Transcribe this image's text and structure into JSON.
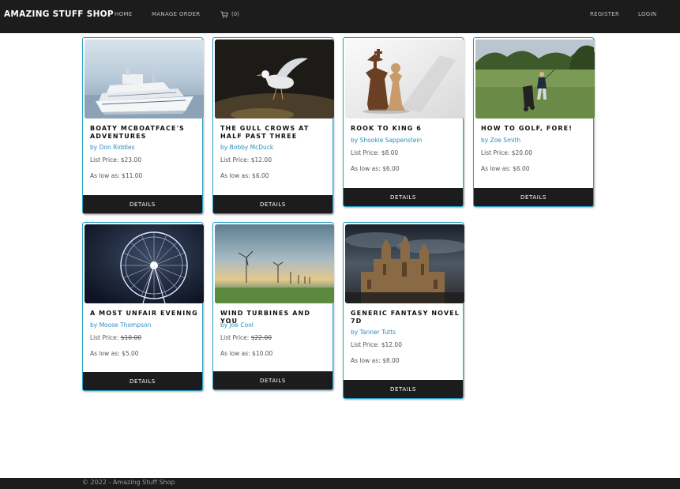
{
  "nav": {
    "brand": "AMAZING STUFF SHOP",
    "home": "HOME",
    "manage_order": "MANAGE ORDER",
    "cart_count": "(0)",
    "register": "REGISTER",
    "login": "LOGIN"
  },
  "books": [
    {
      "title": "BOATY MCBOATFACE'S ADVENTURES",
      "author": "by Don Riddles",
      "list_label": "List Price:",
      "list_price": "$23.00",
      "low_label": "As low as:",
      "low_price": "$11.00",
      "details": "DETAILS"
    },
    {
      "title": "THE GULL CROWS AT HALF PAST THREE",
      "author": "by Bobby McDuck",
      "list_label": "List Price:",
      "list_price": "$12.00",
      "low_label": "As low as:",
      "low_price": "$6.00",
      "details": "DETAILS"
    },
    {
      "title": "ROOK TO KING 6",
      "author": "by Shookie Sappenstein",
      "list_label": "List Price:",
      "list_price": "$8.00",
      "low_label": "As low as:",
      "low_price": "$6.00",
      "details": "DETAILS"
    },
    {
      "title": "HOW TO GOLF, FORE!",
      "author": "by Zoe Smith",
      "list_label": "List Price:",
      "list_price": "$20.00",
      "low_label": "As low as:",
      "low_price": "$6.00",
      "details": "DETAILS"
    },
    {
      "title": "A MOST UNFAIR EVENING",
      "author": "by Moose Thompson",
      "list_label": "List Price:",
      "list_price": "$10.00",
      "low_label": "As low as:",
      "low_price": "$5.00",
      "details": "DETAILS"
    },
    {
      "title": "WIND TURBINES AND YOU",
      "author": "by Joe Cool",
      "list_label": "List Price:",
      "list_price": "$22.00",
      "low_label": "As low as:",
      "low_price": "$10.00",
      "details": "DETAILS"
    },
    {
      "title": "GENERIC FANTASY NOVEL 7D",
      "author": "by Tanner Tutts",
      "list_label": "List Price:",
      "list_price": "$12.00",
      "low_label": "As low as:",
      "low_price": "$8.00",
      "details": "DETAILS"
    }
  ],
  "footer": {
    "text": "© 2022 - Amazing Stuff Shop"
  },
  "colors": {
    "navbar": "#1c1c1c",
    "card_border": "#29a1c7",
    "author_link": "#2a8fc3"
  }
}
